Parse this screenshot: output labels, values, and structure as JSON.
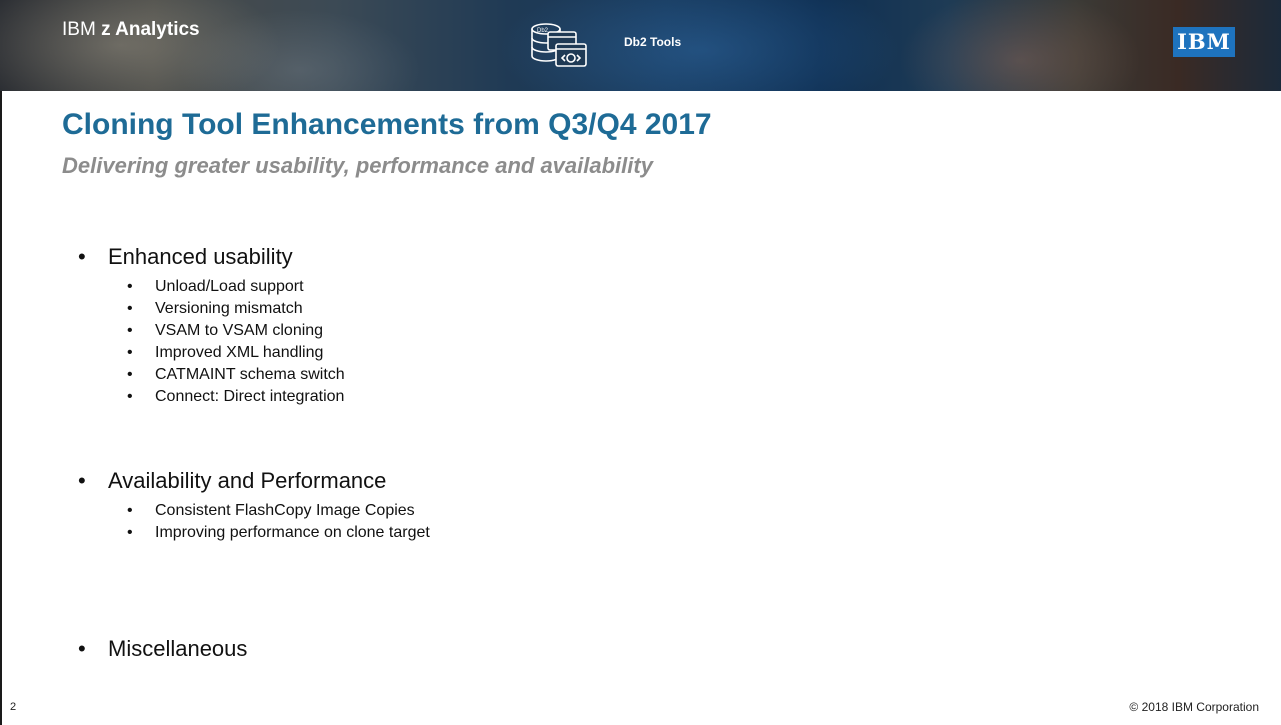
{
  "header": {
    "brand_prefix": "IBM",
    "brand_bold": "z Analytics",
    "product_icon_label": "Db2",
    "product": "Db2 Tools",
    "ibm_logo": "IBM"
  },
  "slide": {
    "title": "Cloning Tool Enhancements from Q3/Q4 2017",
    "subtitle": "Delivering greater usability, performance and availability"
  },
  "bullets": [
    {
      "label": "Enhanced usability",
      "items": [
        "Unload/Load support",
        "Versioning mismatch",
        "VSAM to VSAM cloning",
        "Improved XML handling",
        "CATMAINT schema switch",
        "Connect: Direct integration"
      ]
    },
    {
      "label": "Availability and Performance",
      "items": [
        "Consistent FlashCopy Image Copies",
        "Improving performance on clone target"
      ]
    },
    {
      "label": "Miscellaneous",
      "items": []
    }
  ],
  "footer": {
    "page_number": "2",
    "copyright": "© 2018 IBM Corporation"
  },
  "colors": {
    "title": "#1e6b96",
    "subtitle": "#8c8c8c",
    "ibm_logo_bg": "#1e73be"
  }
}
